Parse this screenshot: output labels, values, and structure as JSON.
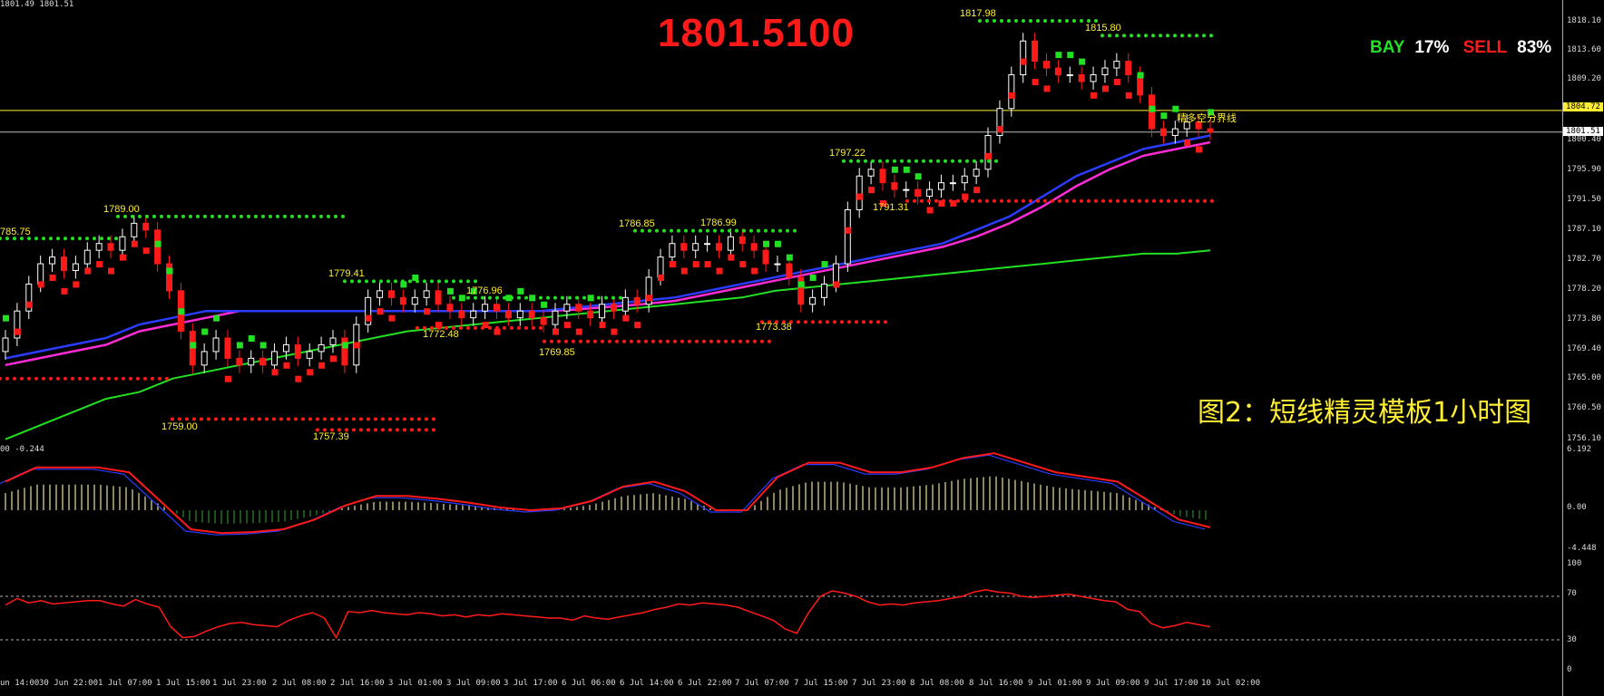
{
  "header": {
    "info": "1801.49 1801.51"
  },
  "current_price": "1801.5100",
  "ratio": {
    "bay_label": "BAY",
    "bay_pct": "17%",
    "sell_label": "SELL",
    "sell_pct": "83%"
  },
  "caption": "图2：短线精灵模板1小时图",
  "boundary_label": "精多空分界线",
  "price_tags": {
    "boundary": "1804.72",
    "current": "1801.51",
    "below_current": "1800.40"
  },
  "price_axis": [
    "1818.10",
    "1813.60",
    "1809.20",
    "1795.90",
    "1791.50",
    "1787.10",
    "1782.70",
    "1778.20",
    "1773.80",
    "1769.40",
    "1765.00",
    "1760.50",
    "1756.10"
  ],
  "peak_labels": [
    "785.75",
    "1789.00",
    "1759.00",
    "1757.39",
    "1779.41",
    "1776.96",
    "1772.48",
    "1769.85",
    "1786.85",
    "1786.99",
    "1773.38",
    "1797.22",
    "1791.31",
    "1817.98",
    "1815.80"
  ],
  "macd": {
    "header": "00 -0.244",
    "axis": [
      "6.192",
      "0.00",
      "-4.448"
    ]
  },
  "rsi": {
    "axis": [
      "100",
      "70",
      "30",
      "0"
    ]
  },
  "time_axis": [
    "un 14:00",
    "30 Jun 22:00",
    "1 Jul 07:00",
    "1 Jul 15:00",
    "1 Jul 23:00",
    "2 Jul 08:00",
    "2 Jul 16:00",
    "3 Jul 01:00",
    "3 Jul 09:00",
    "3 Jul 17:00",
    "6 Jul 06:00",
    "6 Jul 14:00",
    "6 Jul 22:00",
    "7 Jul 07:00",
    "7 Jul 15:00",
    "7 Jul 23:00",
    "8 Jul 08:00",
    "8 Jul 16:00",
    "9 Jul 01:00",
    "9 Jul 09:00",
    "9 Jul 17:00",
    "10 Jul 02:00"
  ],
  "colors": {
    "up": "#ffffff",
    "down": "#ff1a1a",
    "buy": "#22e022",
    "sell": "#ff1a1a",
    "ma_blue": "#2b3cff",
    "ma_magenta": "#ff2bd6",
    "ma_green": "#22e022",
    "boundary": "#ffee33"
  },
  "chart_data": {
    "type": "line",
    "symbol_close": 1801.51,
    "y_range": [
      1756.1,
      1820.0
    ],
    "closes": [
      1771,
      1775,
      1779,
      1782,
      1783,
      1781,
      1782,
      1784,
      1785,
      1784,
      1786,
      1788,
      1787,
      1782,
      1778,
      1772,
      1767,
      1769,
      1771,
      1768,
      1767,
      1768,
      1767,
      1769,
      1770,
      1768,
      1769,
      1770,
      1771,
      1767,
      1773,
      1777,
      1778,
      1777,
      1776,
      1777,
      1778,
      1776,
      1775,
      1774,
      1775,
      1776,
      1775,
      1774,
      1775,
      1774,
      1773,
      1775,
      1776,
      1775,
      1774,
      1776,
      1775,
      1777,
      1776,
      1780,
      1783,
      1785,
      1784,
      1785,
      1785,
      1784,
      1786,
      1785,
      1784,
      1782,
      1782,
      1780,
      1776,
      1777,
      1779,
      1782,
      1790,
      1795,
      1796,
      1794,
      1793,
      1793,
      1792,
      1793,
      1794,
      1794,
      1795,
      1796,
      1801,
      1805,
      1810,
      1815,
      1812,
      1811,
      1810,
      1810,
      1809,
      1810,
      1811,
      1812,
      1810,
      1807,
      1802,
      1801,
      1802,
      1803,
      1802,
      1801.51
    ],
    "ma_blue": [
      1768,
      1769,
      1770,
      1771,
      1773,
      1774,
      1775,
      1775,
      1775,
      1775,
      1775,
      1775,
      1775,
      1775,
      1775,
      1775,
      1775,
      1775.5,
      1776,
      1776.5,
      1777,
      1778,
      1779,
      1780,
      1781,
      1782,
      1783,
      1784,
      1785,
      1787,
      1789,
      1792,
      1795,
      1797,
      1799,
      1800,
      1801
    ],
    "ma_magenta": [
      1767,
      1768,
      1769,
      1770,
      1772,
      1773,
      1774,
      1775,
      1775,
      1775,
      1775,
      1775,
      1775,
      1775,
      1775,
      1775,
      1775,
      1775.2,
      1775.6,
      1776,
      1776.5,
      1777.5,
      1778.5,
      1779.5,
      1780.5,
      1781.5,
      1782.5,
      1783.5,
      1784.5,
      1786,
      1788,
      1790.5,
      1793.5,
      1796,
      1798,
      1799,
      1800
    ],
    "ma_green": [
      1756,
      1758,
      1760,
      1762,
      1763,
      1765,
      1766,
      1767,
      1768,
      1769,
      1770,
      1771,
      1772,
      1772.5,
      1773,
      1773.5,
      1774,
      1774.5,
      1775,
      1775.5,
      1776,
      1776.5,
      1777,
      1778,
      1778.5,
      1779,
      1779.5,
      1780,
      1780.5,
      1781,
      1781.5,
      1782,
      1782.5,
      1783,
      1783.5,
      1783.5,
      1784
    ],
    "macd_signal": [
      3,
      4.5,
      4.5,
      4.5,
      4,
      1,
      -2,
      -2.4,
      -2.3,
      -2,
      -1,
      0.5,
      1.5,
      1.5,
      1.2,
      0.8,
      0.3,
      0,
      0.2,
      1,
      2.5,
      3,
      2,
      0,
      0,
      3.5,
      5,
      5,
      4,
      4,
      4.5,
      5.5,
      6,
      5,
      4,
      3.5,
      3,
      1,
      -1,
      -1.8
    ],
    "rsi": [
      62,
      68,
      64,
      66,
      63,
      64,
      65,
      66,
      66,
      63,
      61,
      67,
      63,
      60,
      42,
      32,
      33,
      38,
      42,
      45,
      46,
      44,
      43,
      42,
      48,
      52,
      55,
      50,
      32,
      56,
      55,
      57,
      55,
      54,
      53,
      55,
      54,
      52,
      53,
      51,
      53,
      52,
      54,
      53,
      52,
      51,
      50,
      50,
      48,
      52,
      50,
      49,
      51,
      53,
      55,
      58,
      60,
      63,
      62,
      64,
      63,
      62,
      60,
      56,
      52,
      48,
      40,
      36,
      55,
      70,
      75,
      73,
      70,
      65,
      62,
      63,
      62,
      64,
      65,
      66,
      68,
      70,
      74,
      76,
      74,
      73,
      70,
      69,
      70,
      71,
      72,
      70,
      68,
      66,
      65,
      58,
      56,
      45,
      41,
      43,
      46,
      44,
      42
    ]
  }
}
